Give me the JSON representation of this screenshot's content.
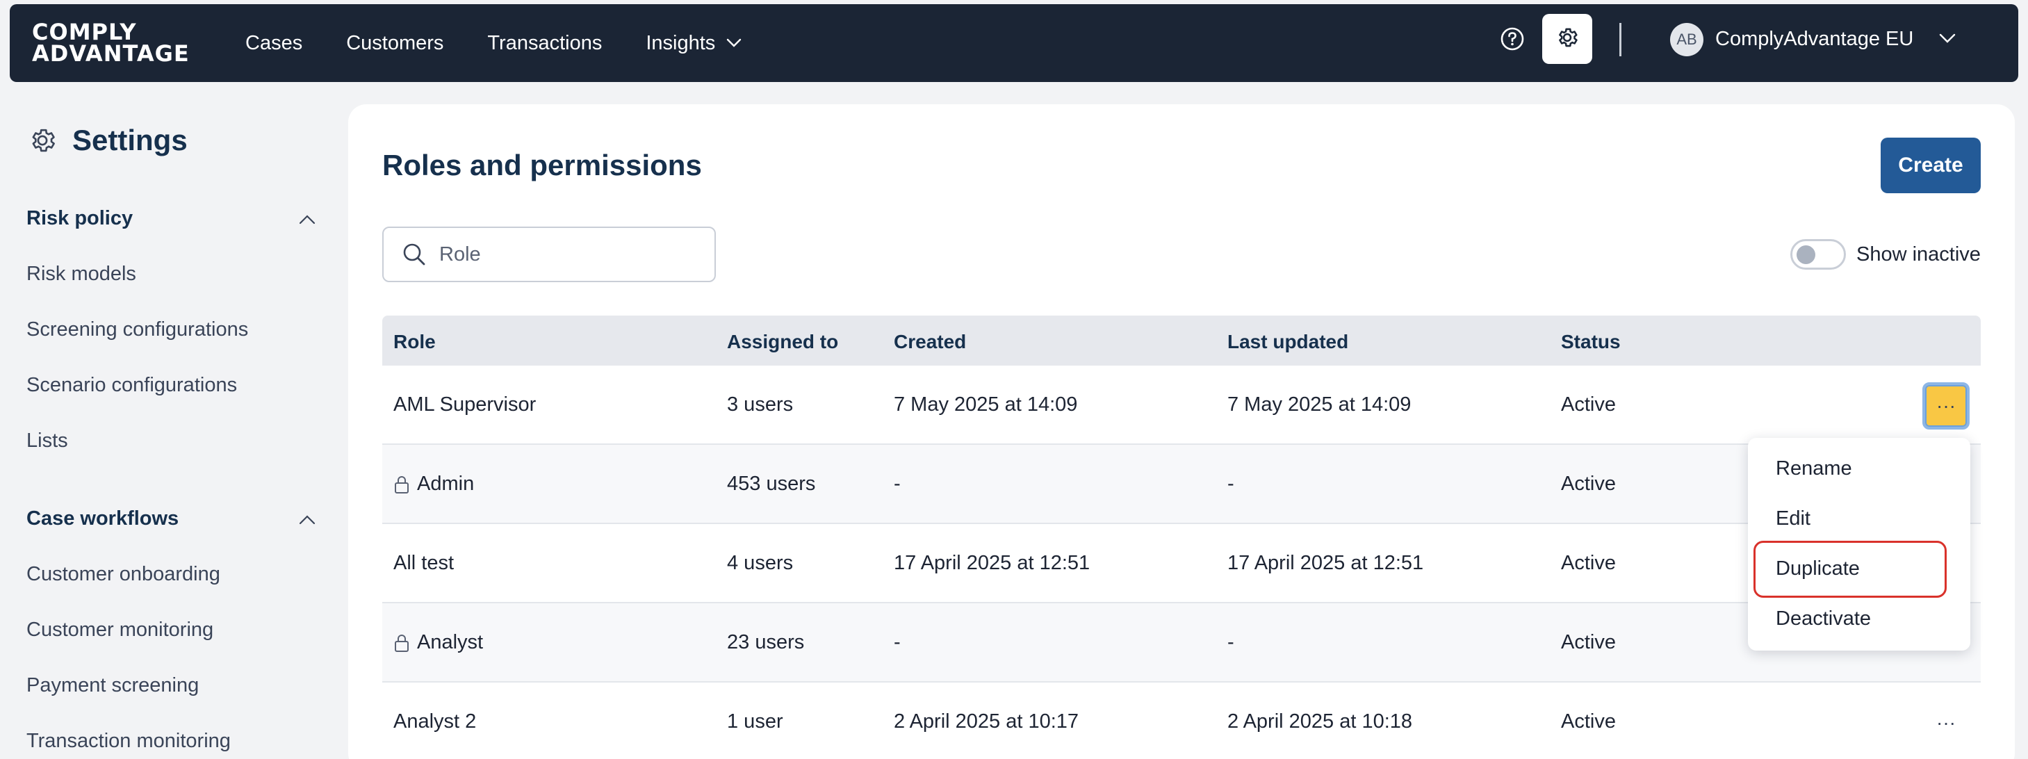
{
  "topbar": {
    "logo_line1": "COMPLY",
    "logo_line2": "ADVANTAGE",
    "nav": [
      "Cases",
      "Customers",
      "Transactions",
      "Insights"
    ],
    "avatar_initials": "AB",
    "org_name": "ComplyAdvantage EU"
  },
  "sidebar": {
    "title": "Settings",
    "sections": [
      {
        "label": "Risk policy",
        "items": [
          "Risk models",
          "Screening configurations",
          "Scenario configurations",
          "Lists"
        ]
      },
      {
        "label": "Case workflows",
        "items": [
          "Customer onboarding",
          "Customer monitoring",
          "Payment screening",
          "Transaction monitoring"
        ]
      }
    ]
  },
  "main": {
    "title": "Roles and permissions",
    "create_label": "Create",
    "search_placeholder": "Role",
    "show_inactive_label": "Show inactive",
    "columns": [
      "Role",
      "Assigned to",
      "Created",
      "Last updated",
      "Status"
    ],
    "rows": [
      {
        "role": "AML Supervisor",
        "locked": false,
        "assigned": "3 users",
        "created": "7 May 2025 at 14:09",
        "updated": "7 May 2025 at 14:09",
        "status": "Active"
      },
      {
        "role": "Admin",
        "locked": true,
        "assigned": "453 users",
        "created": "-",
        "updated": "-",
        "status": "Active"
      },
      {
        "role": "All test",
        "locked": false,
        "assigned": "4 users",
        "created": "17 April 2025 at 12:51",
        "updated": "17 April 2025 at 12:51",
        "status": "Active"
      },
      {
        "role": "Analyst",
        "locked": true,
        "assigned": "23 users",
        "created": "-",
        "updated": "-",
        "status": "Active"
      },
      {
        "role": "Analyst 2",
        "locked": false,
        "assigned": "1 user",
        "created": "2 April 2025 at 10:17",
        "updated": "2 April 2025 at 10:18",
        "status": "Active"
      }
    ],
    "row_menu_glyph": "···",
    "row_menu": [
      "Rename",
      "Edit",
      "Duplicate",
      "Deactivate"
    ]
  },
  "colors": {
    "nav_bg": "#1b2535",
    "primary": "#235a97",
    "menu_button_active": "#f9c744",
    "highlight_outline": "#d9322b"
  }
}
